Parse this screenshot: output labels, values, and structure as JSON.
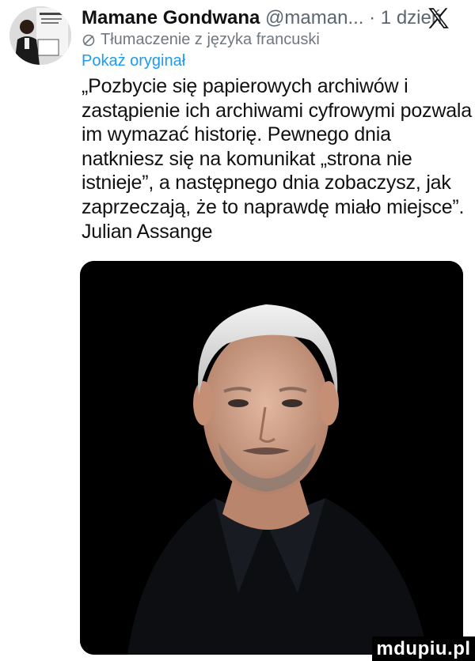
{
  "tweet": {
    "author_name": "Mamane Gondwana",
    "handle": "@maman...",
    "separator": "·",
    "time": "1 dzień",
    "translated_label": "Tłumaczenie z języka francuski",
    "show_original": "Pokaż oryginał",
    "text_lines": [
      "„Pozbycie się papierowych archiwów i",
      "zastąpienie ich archiwami cyfrowymi pozwala",
      "im wymazać historię. Pewnego dnia",
      "natkniesz się na komunikat „strona nie",
      "istnieje”, a następnego dnia zobaczysz, jak",
      "zaprzeczają, że to naprawdę miało miejsce”.",
      "Julian Assange"
    ]
  },
  "icons": {
    "platform_logo": "x-logo-icon",
    "translate": "translate-icon"
  },
  "watermark": "mdupiu.pl",
  "colors": {
    "text": "#111111",
    "muted": "#5b6670",
    "link": "#1d9bf0",
    "photo_bg": "#000000"
  }
}
